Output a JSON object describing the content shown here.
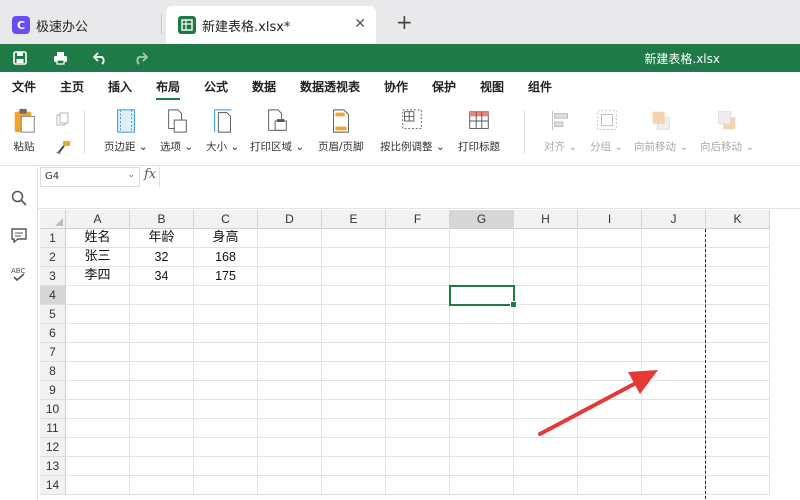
{
  "tabs": [
    {
      "label": "极速办公",
      "icon": "app-logo-icon"
    },
    {
      "label": "新建表格.xlsx*",
      "icon": "spreadsheet-icon",
      "close": "✕"
    }
  ],
  "new_tab": "+",
  "doc_title": "新建表格.xlsx",
  "menu": [
    "文件",
    "主页",
    "插入",
    "布局",
    "公式",
    "数据",
    "数据透视表",
    "协作",
    "保护",
    "视图",
    "组件"
  ],
  "active_menu": "布局",
  "ribbon": {
    "paste": "粘贴",
    "margins": "页边距",
    "orientation": "选项",
    "size": "大小",
    "print_area": "打印区域",
    "header_footer": "页眉/页脚",
    "scale_to_fit": "按比例调整",
    "print_titles": "打印标题",
    "align": "对齐",
    "group": "分组",
    "bring_forward": "向前移动",
    "send_backward": "向后移动"
  },
  "namebox": "G4",
  "fx": "fx",
  "columns": [
    "A",
    "B",
    "C",
    "D",
    "E",
    "F",
    "G",
    "H",
    "I",
    "J",
    "K"
  ],
  "selected_column": "G",
  "rows": [
    "1",
    "2",
    "3",
    "4",
    "5",
    "6",
    "7",
    "8",
    "9",
    "10",
    "11",
    "12",
    "13",
    "14"
  ],
  "selected_row": "4",
  "cells": {
    "r1": [
      "姓名",
      "年龄",
      "身高"
    ],
    "r2": [
      "张三",
      "32",
      "168"
    ],
    "r3": [
      "李四",
      "34",
      "175"
    ]
  },
  "colors": {
    "brand_green": "#1e7b48",
    "arrow_red": "#e53935"
  }
}
